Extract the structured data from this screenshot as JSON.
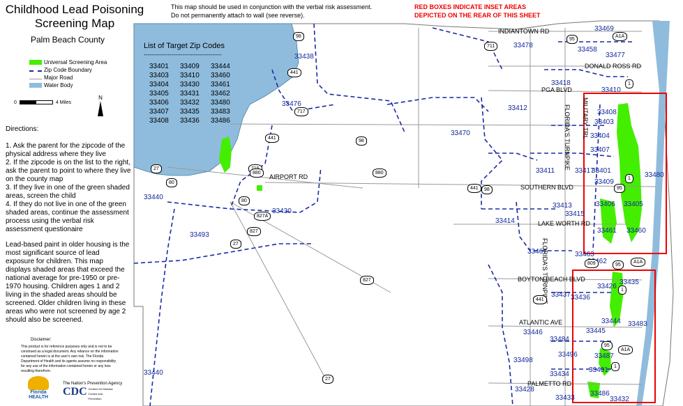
{
  "title": "Childhood Lead Poisoning Screening Map",
  "county": "Palm Beach County",
  "top_note": "This map should be used in conjunction with the verbal risk assessment.\nDo not permanently attach to wall (see reverse).",
  "red_note": "RED BOXES INDICATE INSET AREAS\nDEPICTED ON THE REAR OF THIS SHEET",
  "legend": [
    {
      "label": "Universal Screening Area",
      "color": "#44ee00"
    },
    {
      "label": "Zip Code Boundary",
      "color": "#1a2aa6"
    },
    {
      "label": "Major Road",
      "color": "#999999"
    },
    {
      "label": "Water Body",
      "color": "#8fbcdc"
    }
  ],
  "scale": {
    "start": "0",
    "end": "4",
    "unit": "Miles",
    "north": "N"
  },
  "directions_heading": "Directions:",
  "directions": "1. Ask the parent for the zipcode of the physical address where they live\n2. If the zipcode is on the list to the right, ask the parent to point to where they live on the county map\n3. If they live in one of the green shaded areas, screen the child\n4. If they do not live in one of the green shaded areas, continue the assessment process using the verbal risk assessment questionaire",
  "lead_paragraph": "Lead-based paint in older housing is the most significant source of lead exposure for children. This map displays shaded areas that exceed the national average for pre-1950 or pre-1970 housing. Children ages 1 and 2 living in the shaded areas should be screened. Older children living in these areas who were not screened by age 2 should also be screened.",
  "disclaimer_heading": "Disclaimer:",
  "disclaimer": "This product is for reference purposes only and is not to be construed as a legal document. Any reliance on the information contained herein is at the user's own risk. The Florida Department of Health and its agents assume no responsibility for any use of the information contained herein or any loss resulting therefrom.",
  "logos": {
    "florida": "Florida HEALTH",
    "cdc": "CDC",
    "cdc_tag": "The Nation's Prevention Agency",
    "cdc_sub": "Centers for Disease Control and Prevention"
  },
  "target_zips": {
    "heading": "List of Target Zip Codes",
    "rule": "------------------------------------------",
    "codes": [
      "33401",
      "33409",
      "33444",
      "33403",
      "33410",
      "33460",
      "33404",
      "33430",
      "33461",
      "33405",
      "33431",
      "33462",
      "33406",
      "33432",
      "33480",
      "33407",
      "33435",
      "33483",
      "33408",
      "33436",
      "33486"
    ]
  },
  "map_zips": [
    {
      "t": "33438"
    },
    {
      "t": "33478"
    },
    {
      "t": "33469"
    },
    {
      "t": "33458"
    },
    {
      "t": "33477"
    },
    {
      "t": "33418"
    },
    {
      "t": "33410"
    },
    {
      "t": "33476"
    },
    {
      "t": "33412"
    },
    {
      "t": "33408"
    },
    {
      "t": "33403"
    },
    {
      "t": "33470"
    },
    {
      "t": "33404"
    },
    {
      "t": "33407"
    },
    {
      "t": "33411"
    },
    {
      "t": "33417"
    },
    {
      "t": "33401"
    },
    {
      "t": "33409"
    },
    {
      "t": "33480"
    },
    {
      "t": "33440"
    },
    {
      "t": "33413"
    },
    {
      "t": "33406"
    },
    {
      "t": "33405"
    },
    {
      "t": "33430"
    },
    {
      "t": "33415"
    },
    {
      "t": "33414"
    },
    {
      "t": "33493"
    },
    {
      "t": "33461"
    },
    {
      "t": "33460"
    },
    {
      "t": "33467"
    },
    {
      "t": "33463"
    },
    {
      "t": "33462"
    },
    {
      "t": "33435"
    },
    {
      "t": "33426"
    },
    {
      "t": "33437"
    },
    {
      "t": "33436"
    },
    {
      "t": "33483"
    },
    {
      "t": "33445"
    },
    {
      "t": "33444"
    },
    {
      "t": "33446"
    },
    {
      "t": "33484"
    },
    {
      "t": "33487"
    },
    {
      "t": "33496"
    },
    {
      "t": "33498"
    },
    {
      "t": "33440"
    },
    {
      "t": "33431"
    },
    {
      "t": "33434"
    },
    {
      "t": "33428"
    },
    {
      "t": "33486"
    },
    {
      "t": "33433"
    },
    {
      "t": "33432"
    }
  ],
  "road_labels": [
    "INDIANTOWN RD",
    "DONALD ROSS RD",
    "PGA BLVD",
    "AIRPORT RD",
    "SOUTHERN BLVD",
    "LAKE WORTH RD",
    "BOYTON BEACH BLVD",
    "ATLANTIC AVE",
    "PALMETTO RD",
    "FLORIDA'S TURNPIKE",
    "MILITARY TRL",
    "FLORIDA'S TURNPIKE"
  ],
  "shields": [
    "98",
    "441",
    "717",
    "711",
    "95",
    "A1A",
    "1",
    "441",
    "98",
    "715",
    "27",
    "80",
    "880",
    "80",
    "880",
    "441",
    "98",
    "827A",
    "827",
    "27",
    "827",
    "441",
    "809",
    "95",
    "A1A",
    "441",
    "95",
    "A1A",
    "27",
    "1",
    "1",
    "95",
    "1"
  ]
}
